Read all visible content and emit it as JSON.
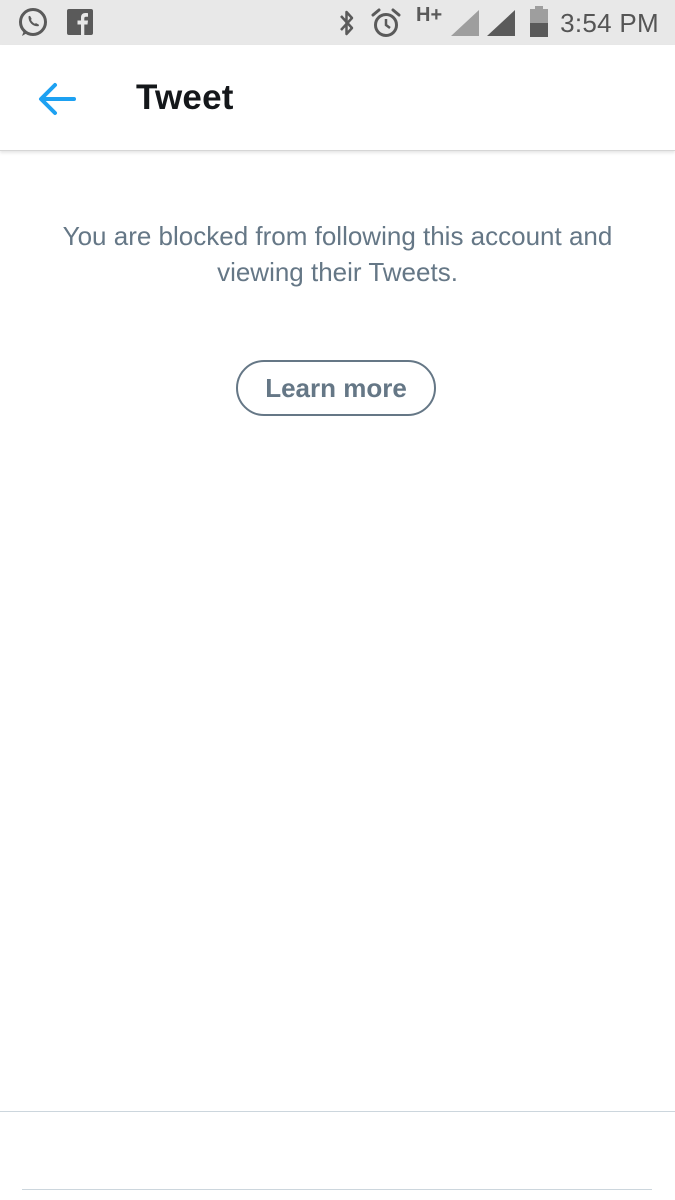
{
  "status_bar": {
    "time": "3:54 PM",
    "network_type": "H+",
    "icons": [
      "whatsapp-icon",
      "facebook-icon",
      "bluetooth-icon",
      "alarm-icon",
      "signal-icon",
      "battery-icon"
    ]
  },
  "header": {
    "title": "Tweet",
    "back_icon": "arrow-left-icon"
  },
  "main": {
    "message": "You are blocked from following this account and viewing their Tweets.",
    "learn_more_label": "Learn more"
  },
  "colors": {
    "accent": "#1da1f2",
    "text_secondary": "#657786",
    "text_primary": "#14171a",
    "status_bar_bg": "#e8e8e8"
  }
}
